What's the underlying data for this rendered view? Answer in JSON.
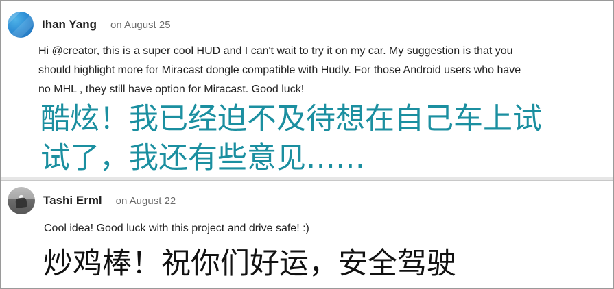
{
  "comments": [
    {
      "author": "Ihan Yang",
      "date": "on August 25",
      "body": "Hi @creator, this is a super cool HUD and I can't wait to try it on my car. My suggestion is that you\nshould highlight more for Miracast dongle compatible with Hudly. For those Android users who have\nno MHL , they still have option for Miracast. Good luck!",
      "translation": "酷炫！我已经迫不及待想在自己车上试\n试了，我还有些意见……",
      "translation_color": "#1b8fa0",
      "avatar_icon": "blue-pattern-avatar"
    },
    {
      "author": "Tashi Erml",
      "date": "on August 22",
      "body": "Cool idea! Good luck with this project and drive safe! :)",
      "translation": "炒鸡棒！祝你们好运，安全驾驶",
      "translation_color": "#111111",
      "avatar_icon": "photo-avatar"
    }
  ]
}
